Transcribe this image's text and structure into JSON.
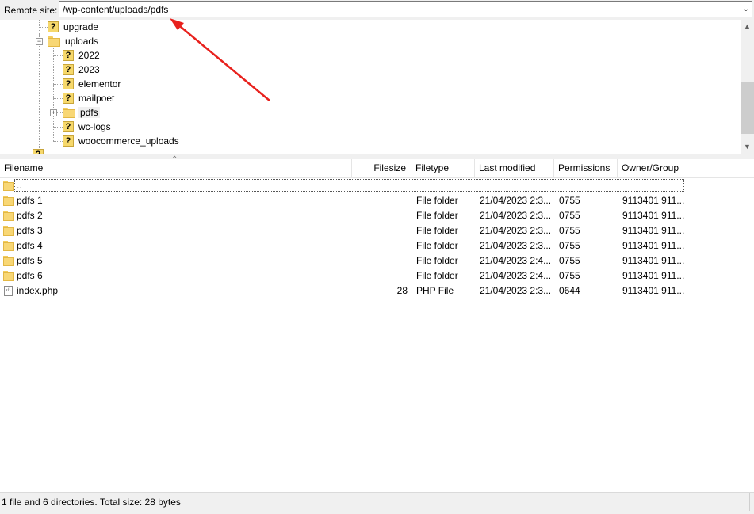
{
  "remote_site": {
    "label": "Remote site:",
    "path": "/wp-content/uploads/pdfs"
  },
  "tree": {
    "items": [
      {
        "label": "upgrade",
        "icon": "question-folder-icon"
      },
      {
        "label": "uploads",
        "icon": "folder-icon"
      },
      {
        "label": "2022",
        "icon": "question-folder-icon"
      },
      {
        "label": "2023",
        "icon": "question-folder-icon"
      },
      {
        "label": "elementor",
        "icon": "question-folder-icon"
      },
      {
        "label": "mailpoet",
        "icon": "question-folder-icon"
      },
      {
        "label": "pdfs",
        "icon": "folder-icon"
      },
      {
        "label": "wc-logs",
        "icon": "question-folder-icon"
      },
      {
        "label": "woocommerce_uploads",
        "icon": "question-folder-icon"
      }
    ]
  },
  "file_list": {
    "columns": [
      "Filename",
      "Filesize",
      "Filetype",
      "Last modified",
      "Permissions",
      "Owner/Group"
    ],
    "parent_label": "..",
    "rows": [
      {
        "name": "pdfs 1",
        "size": "",
        "type": "File folder",
        "modified": "21/04/2023 2:3...",
        "perms": "0755",
        "owner": "9113401 911...",
        "icon": "folder-icon"
      },
      {
        "name": "pdfs 2",
        "size": "",
        "type": "File folder",
        "modified": "21/04/2023 2:3...",
        "perms": "0755",
        "owner": "9113401 911...",
        "icon": "folder-icon"
      },
      {
        "name": "pdfs 3",
        "size": "",
        "type": "File folder",
        "modified": "21/04/2023 2:3...",
        "perms": "0755",
        "owner": "9113401 911...",
        "icon": "folder-icon"
      },
      {
        "name": "pdfs 4",
        "size": "",
        "type": "File folder",
        "modified": "21/04/2023 2:3...",
        "perms": "0755",
        "owner": "9113401 911...",
        "icon": "folder-icon"
      },
      {
        "name": "pdfs 5",
        "size": "",
        "type": "File folder",
        "modified": "21/04/2023 2:4...",
        "perms": "0755",
        "owner": "9113401 911...",
        "icon": "folder-icon"
      },
      {
        "name": "pdfs 6",
        "size": "",
        "type": "File folder",
        "modified": "21/04/2023 2:4...",
        "perms": "0755",
        "owner": "9113401 911...",
        "icon": "folder-icon"
      },
      {
        "name": "index.php",
        "size": "28",
        "type": "PHP File",
        "modified": "21/04/2023 2:3...",
        "perms": "0644",
        "owner": "9113401 911...",
        "icon": "php-file-icon"
      }
    ]
  },
  "status_bar": {
    "text": "1 file and 6 directories. Total size: 28 bytes"
  },
  "colors": {
    "annotation_arrow": "#e8211d",
    "folder": "#f8d775",
    "panel_bg": "#f0f0f0"
  }
}
